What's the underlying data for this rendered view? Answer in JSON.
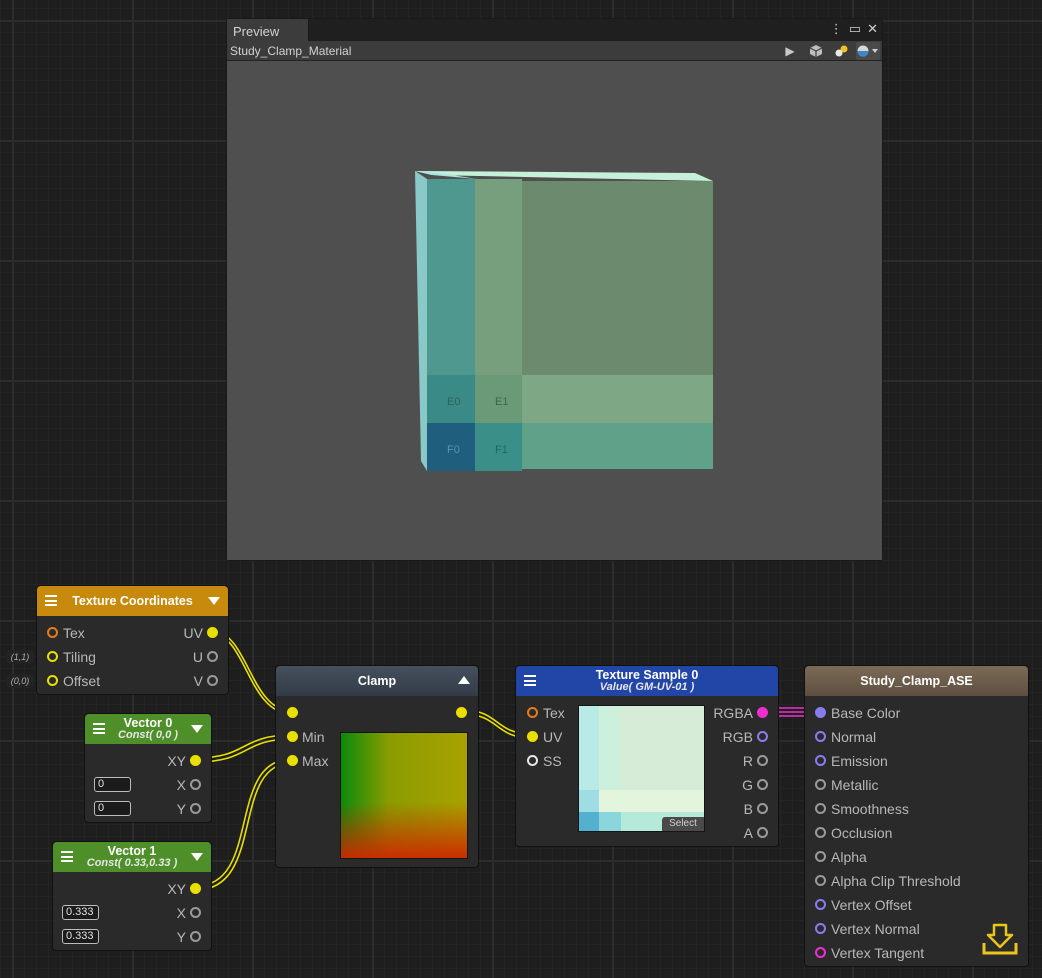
{
  "preview": {
    "tab": "Preview",
    "title": "Study_Clamp_Material",
    "cube_labels": [
      "E0",
      "E1",
      "F0",
      "F1"
    ]
  },
  "texcoord": {
    "title": "Texture Coordinates",
    "inputs": [
      "Tex",
      "Tiling",
      "Offset"
    ],
    "outputs": [
      "UV",
      "U",
      "V"
    ],
    "tiling_hint": "(1,1)",
    "offset_hint": "(0,0)"
  },
  "vector0": {
    "title": "Vector 0",
    "subtitle": "Const( 0,0 )",
    "output": "XY",
    "x_label": "X",
    "y_label": "Y",
    "x_value": "0",
    "y_value": "0"
  },
  "vector1": {
    "title": "Vector 1",
    "subtitle": "Const( 0.33,0.33 )",
    "output": "XY",
    "x_label": "X",
    "y_label": "Y",
    "x_value": "0.333",
    "y_value": "0.333"
  },
  "clamp": {
    "title": "Clamp",
    "inputs": [
      "",
      "Min",
      "Max"
    ]
  },
  "texsample": {
    "title": "Texture Sample 0",
    "subtitle": "Value( GM-UV-01 )",
    "inputs": [
      "Tex",
      "UV",
      "SS"
    ],
    "outputs": [
      "RGBA",
      "RGB",
      "R",
      "G",
      "B",
      "A"
    ],
    "select_label": "Select"
  },
  "output_node": {
    "title": "Study_Clamp_ASE",
    "inputs": [
      "Base Color",
      "Normal",
      "Emission",
      "Metallic",
      "Smoothness",
      "Occlusion",
      "Alpha",
      "Alpha Clip Threshold",
      "Vertex Offset",
      "Vertex Normal",
      "Vertex Tangent"
    ]
  },
  "colors": {
    "canvas": "#1e1e1e",
    "texcoord_header": "#c88a0c",
    "vector_header": "#4e8f2a",
    "clamp_header": "#3a4553",
    "texsample_header": "#2246a8",
    "output_header": "#6e5d4c",
    "float_port": "#e8e000",
    "color_port": "#ee2ecf",
    "vector_port": "#8a7cf0"
  },
  "icons": [
    "play-icon",
    "cube-icon",
    "lights-icon",
    "sphere-icon",
    "more-icon",
    "maximize-icon",
    "close-icon",
    "download-icon",
    "hamburger-icon"
  ]
}
